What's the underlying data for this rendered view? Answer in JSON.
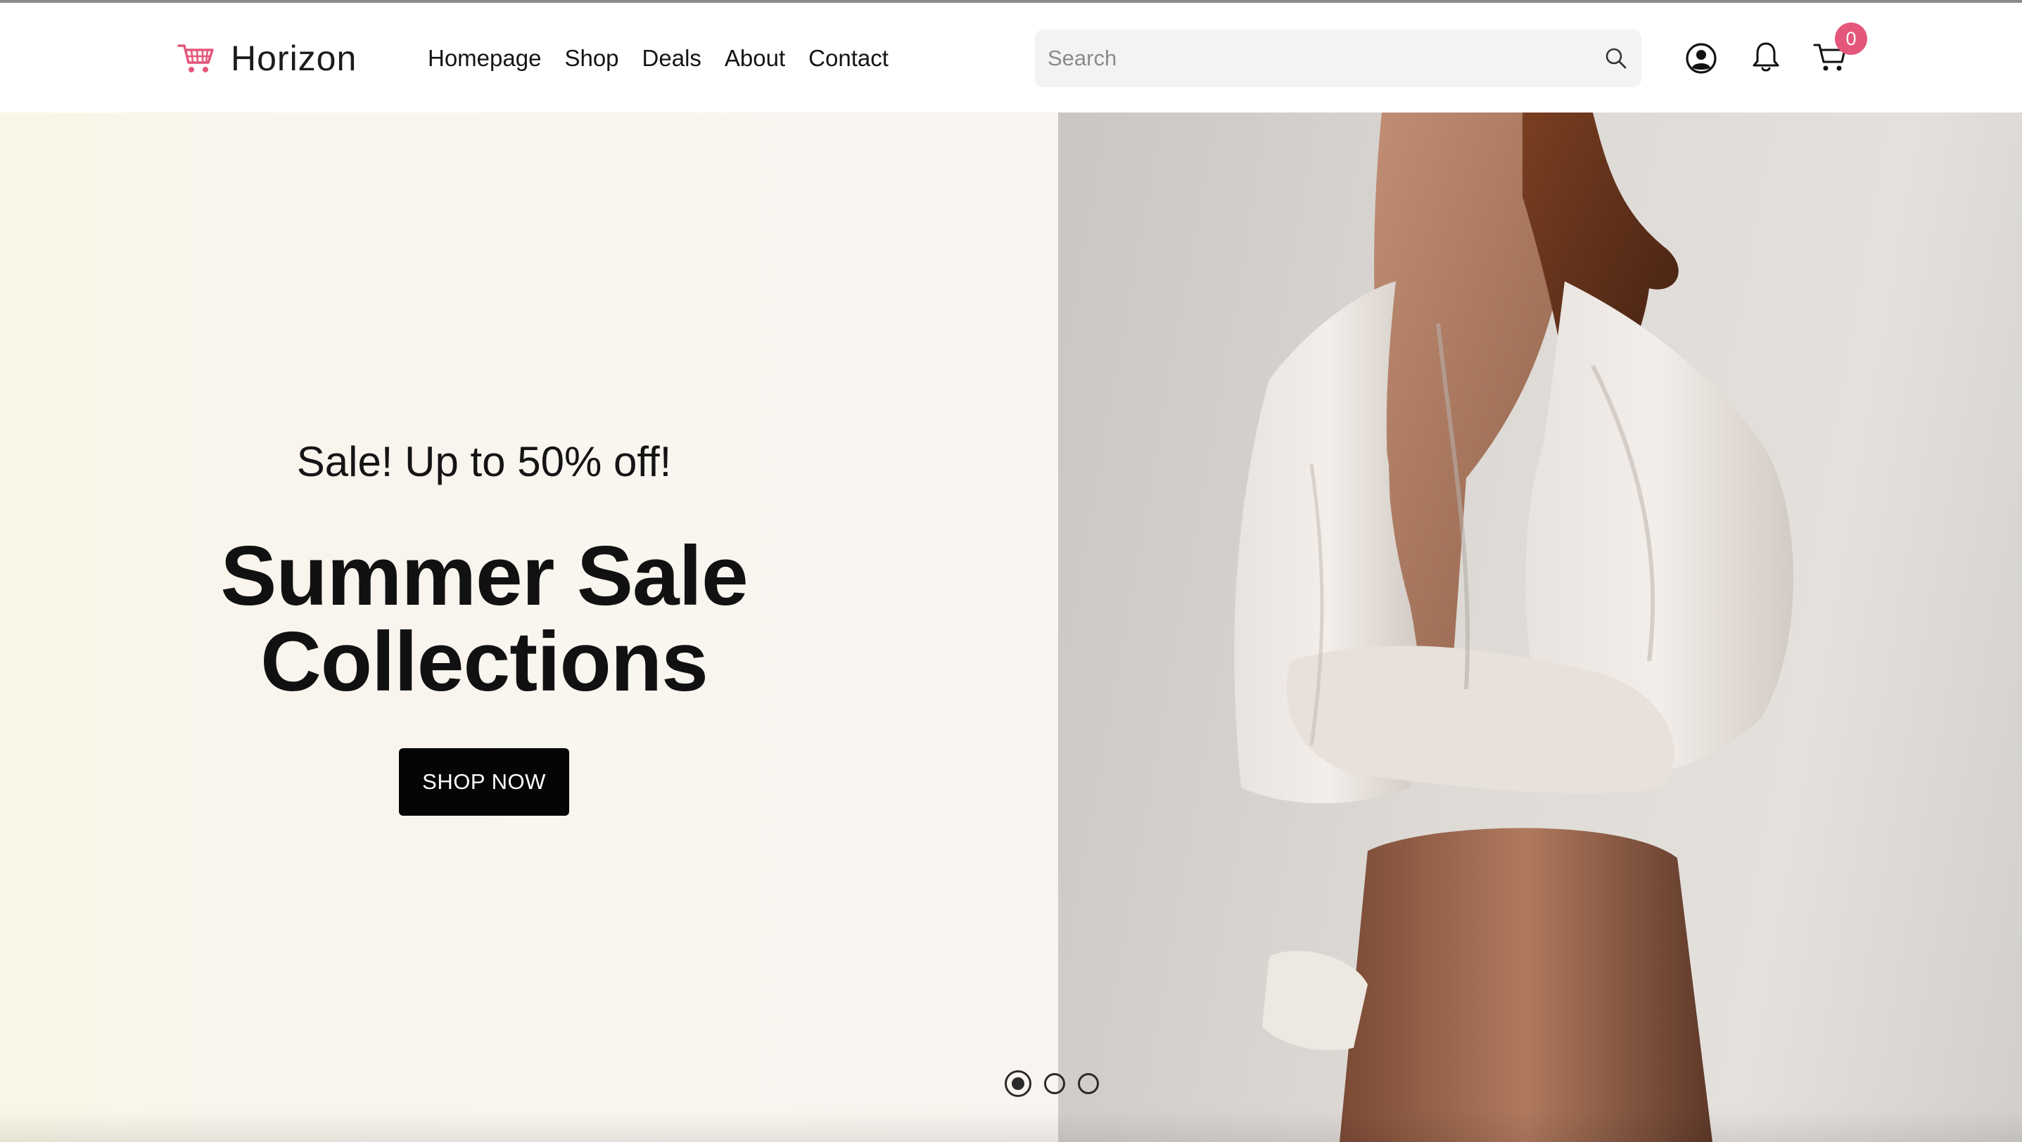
{
  "brand": {
    "name": "Horizon",
    "accent_color": "#e4577a",
    "logo_icon": "shopping-cart-icon"
  },
  "nav": {
    "items": [
      {
        "label": "Homepage"
      },
      {
        "label": "Shop"
      },
      {
        "label": "Deals"
      },
      {
        "label": "About"
      },
      {
        "label": "Contact"
      }
    ]
  },
  "search": {
    "placeholder": "Search",
    "icon": "search-icon"
  },
  "header_icons": {
    "account": "account-icon",
    "notifications": "bell-icon",
    "cart": "cart-icon",
    "cart_count": "0"
  },
  "hero": {
    "kicker": "Sale! Up to 50% off!",
    "title_line1": "Summer Sale",
    "title_line2": "Collections",
    "cta_label": "SHOP NOW",
    "slides": 3,
    "active_slide": 1
  }
}
